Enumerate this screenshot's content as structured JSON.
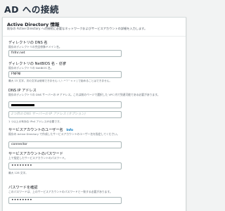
{
  "page": {
    "title": "AD への接続"
  },
  "panel": {
    "title": "Active Directory 情報",
    "description": "既存の Active Directory への接続に必要なネットワークおよびサービスアカウントの詳細を入力します。"
  },
  "dns_name": {
    "label": "ディレクトリの DNS 名",
    "description": "既存のディレクトリの完全修飾ドメイン名。",
    "value": "fnfnr.net"
  },
  "netbios_name": {
    "label": "ディレクトリの NetBIOS 名",
    "optional": "- 任意",
    "description": "既存のディレクトリの NetBIOS 名。",
    "value": "FNFNI",
    "hint": "最大 15 文字。次の文字は使用できません: \\ / : * ? \" < > |   で始めることはできません。"
  },
  "dns_ip": {
    "label": "DNS IP アドレス",
    "description": "既存のディレクトリの DNS サーバーの IP アドレス。これは前のページで選択した VPC 内で到達可能である必要があります。",
    "value_redacted": true,
    "secondary_placeholder": "2つ目の DNS サーバーの IP アドレス (オプション)",
    "hint": "1 つ以上の有効な IPv4 アドレスが必要です。"
  },
  "service_username": {
    "label": "サービスアカウントのユーザー名",
    "info": "Info",
    "description": "既存の Active Directory で作成したサービスアカウントのユーザー名を指定してください。",
    "value": "connector"
  },
  "service_password": {
    "label": "サービスアカウントのパスワード",
    "description": "上で指定したサービスアカウントのパスワード。",
    "value": "••••••••",
    "hint": "最大 128 文字。"
  },
  "confirm_password": {
    "label": "パスワードを確認",
    "description": "このパスワードは、上のサービスアカウントのパスワードと一致する必要があります。",
    "value": "••••••••"
  }
}
